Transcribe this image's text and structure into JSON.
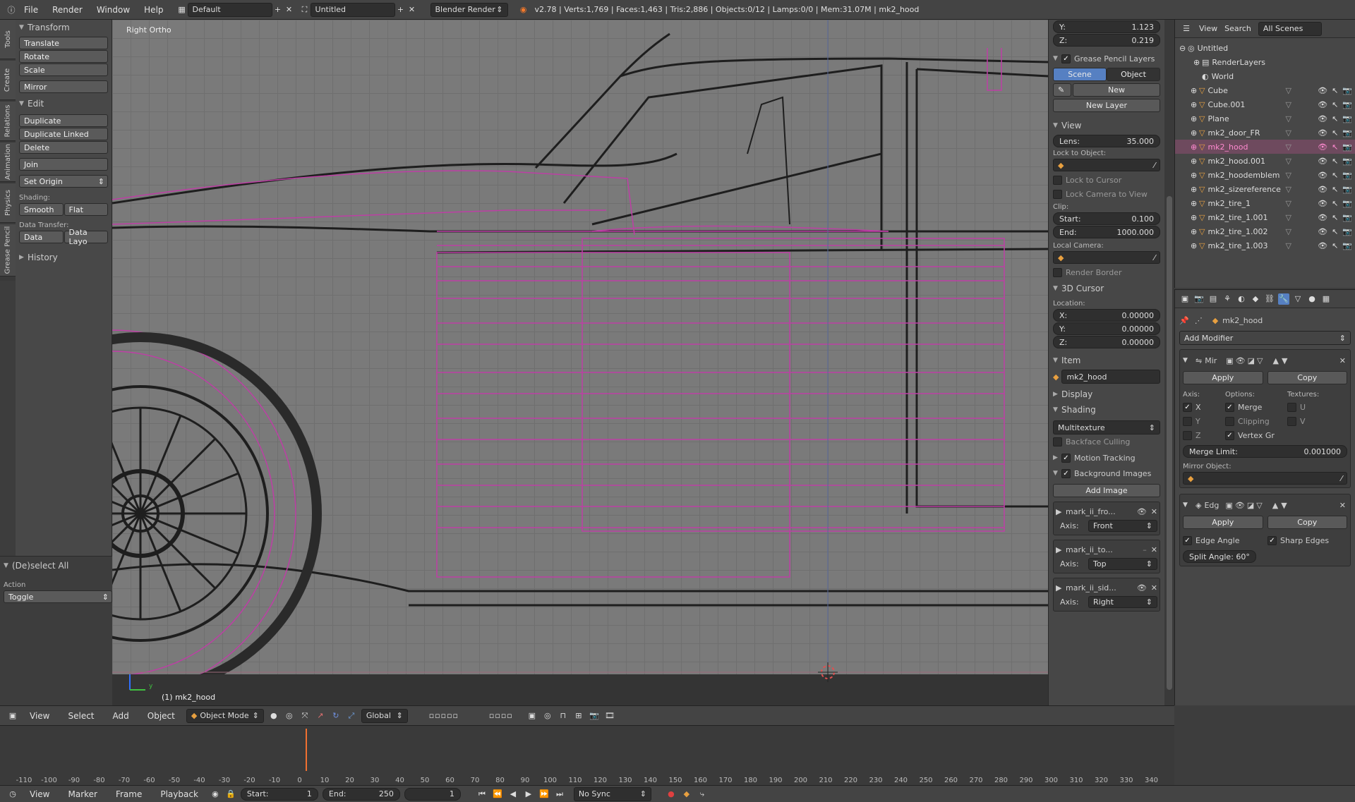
{
  "topbar": {
    "menus": [
      "File",
      "Render",
      "Window",
      "Help"
    ],
    "layout": "Default",
    "scene": "Untitled",
    "engine": "Blender Render",
    "stats": "v2.78 | Verts:1,769 | Faces:1,463 | Tris:2,886 | Objects:0/12 | Lamps:0/0 | Mem:31.07M | mk2_hood"
  },
  "vtabs": [
    "Tools",
    "Create",
    "Relations",
    "Animation",
    "Physics",
    "Grease Pencil"
  ],
  "toolshelf": {
    "transform_title": "Transform",
    "transform": [
      "Translate",
      "Rotate",
      "Scale"
    ],
    "mirror": "Mirror",
    "edit_title": "Edit",
    "edit": [
      "Duplicate",
      "Duplicate Linked",
      "Delete"
    ],
    "join": "Join",
    "set_origin": "Set Origin",
    "shading_label": "Shading:",
    "smooth": "Smooth",
    "flat": "Flat",
    "data_transfer_label": "Data Transfer:",
    "data": "Data",
    "data_layout": "Data Layo",
    "history": "History",
    "deselect_title": "(De)select All",
    "action_label": "Action",
    "action_value": "Toggle"
  },
  "viewport": {
    "view_label": "Right Ortho",
    "object_label": "(1) mk2_hood",
    "axis_y": "y"
  },
  "nprops": {
    "y_label": "Y:",
    "y_value": "1.123",
    "z_label": "Z:",
    "z_value": "0.219",
    "gp_layers": "Grease Pencil Layers",
    "scene_tab": "Scene",
    "object_tab": "Object",
    "new": "New",
    "new_layer": "New Layer",
    "view_title": "View",
    "lens_label": "Lens:",
    "lens_value": "35.000",
    "lock_to_object": "Lock to Object:",
    "lock_cursor": "Lock to Cursor",
    "lock_camera": "Lock Camera to View",
    "clip": "Clip:",
    "start_label": "Start:",
    "start_value": "0.100",
    "end_label": "End:",
    "end_value": "1000.000",
    "local_camera": "Local Camera:",
    "render_border": "Render Border",
    "cursor_title": "3D Cursor",
    "location": "Location:",
    "cx": "0.00000",
    "cy": "0.00000",
    "cz": "0.00000",
    "x_label": "X:",
    "item_title": "Item",
    "item_name": "mk2_hood",
    "display_title": "Display",
    "shading_title": "Shading",
    "shading_mode": "Multitexture",
    "backface": "Backface Culling",
    "motion_tracking": "Motion Tracking",
    "bg_images": "Background Images",
    "add_image": "Add Image",
    "bg1_name": "mark_ii_fro...",
    "bg1_axis": "Front",
    "bg2_name": "mark_ii_to...",
    "bg2_axis": "Top",
    "bg3_name": "mark_ii_sid...",
    "bg3_axis": "Right",
    "axis_label": "Axis:"
  },
  "outliner": {
    "view": "View",
    "search": "Search",
    "scenes": "All Scenes",
    "root": "Untitled",
    "render_layers": "RenderLayers",
    "world": "World",
    "objects": [
      "Cube",
      "Cube.001",
      "Plane",
      "mk2_door_FR",
      "mk2_hood",
      "mk2_hood.001",
      "mk2_hoodemblem",
      "mk2_sizereference",
      "mk2_tire_1",
      "mk2_tire_1.001",
      "mk2_tire_1.002",
      "mk2_tire_1.003"
    ],
    "selected": "mk2_hood"
  },
  "props": {
    "object_name": "mk2_hood",
    "add_modifier": "Add Modifier",
    "mod1_name": "Mir",
    "apply": "Apply",
    "copy": "Copy",
    "axis": "Axis:",
    "options": "Options:",
    "textures": "Textures:",
    "x": "X",
    "y": "Y",
    "z": "Z",
    "merge": "Merge",
    "clipping": "Clipping",
    "vertex_gr": "Vertex Gr",
    "u": "U",
    "v": "V",
    "merge_limit_label": "Merge Limit:",
    "merge_limit_value": "0.001000",
    "mirror_object": "Mirror Object:",
    "mod2_name": "Edg",
    "edge_angle": "Edge Angle",
    "sharp_edges": "Sharp Edges",
    "split_angle": "Split Angle: 60°"
  },
  "vphdr": {
    "view": "View",
    "select": "Select",
    "add": "Add",
    "object": "Object",
    "mode": "Object Mode",
    "orientation": "Global"
  },
  "timeline": {
    "ticks": [
      "-110",
      "-100",
      "-90",
      "-80",
      "-70",
      "-60",
      "-50",
      "-40",
      "-30",
      "-20",
      "-10",
      "0",
      "10",
      "20",
      "30",
      "40",
      "50",
      "60",
      "70",
      "80",
      "90",
      "100",
      "110",
      "120",
      "130",
      "140",
      "150",
      "160",
      "170",
      "180",
      "190",
      "200",
      "210",
      "220",
      "230",
      "240",
      "250",
      "260",
      "270",
      "280",
      "290",
      "300",
      "310",
      "320",
      "330",
      "340"
    ]
  },
  "tlhdr": {
    "view": "View",
    "marker": "Marker",
    "frame": "Frame",
    "playback": "Playback",
    "start_label": "Start:",
    "start_value": "1",
    "end_label": "End:",
    "end_value": "250",
    "current": "1",
    "sync": "No Sync"
  }
}
